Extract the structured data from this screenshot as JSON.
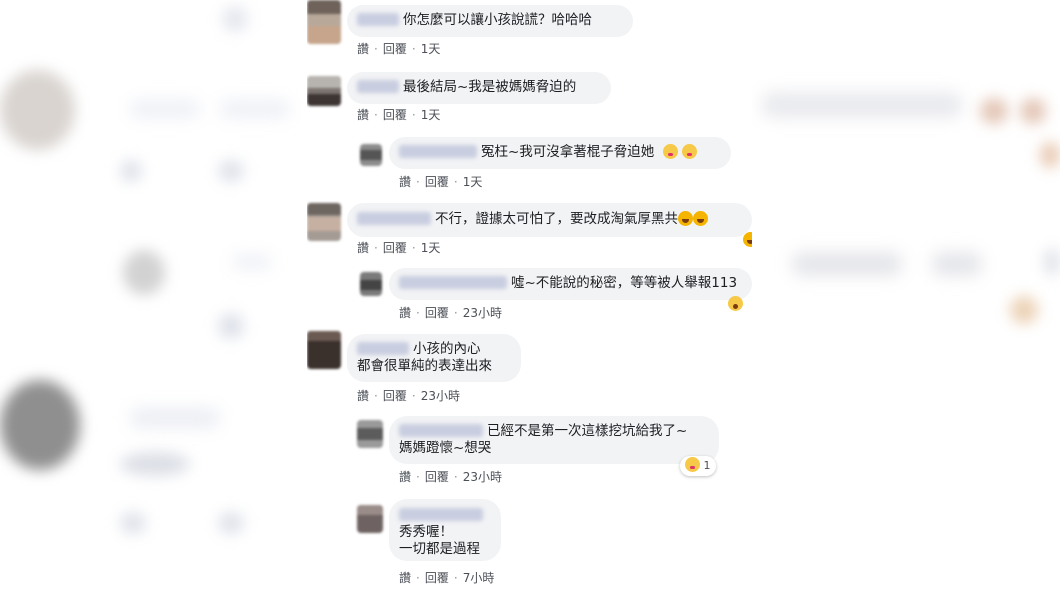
{
  "comments": [
    {
      "text": "你怎麼可以讓小孩說謊？哈哈哈",
      "like": "讚",
      "reply": "回覆",
      "time": "1天"
    },
    {
      "text": "最後結局~我是被媽媽脅迫的",
      "like": "讚",
      "reply": "回覆",
      "time": "1天"
    },
    {
      "text": "冤枉~我可沒拿著棍子脅迫她",
      "like": "讚",
      "reply": "回覆",
      "time": "1天",
      "emojis": [
        "kiss-emoji",
        "kiss-emoji"
      ]
    },
    {
      "text": "不行，證據太可怕了，要改成淘氣厚黑共",
      "like": "讚",
      "reply": "回覆",
      "time": "1天",
      "emojis": [
        "laugh-emoji",
        "laugh-emoji"
      ]
    },
    {
      "text": "噓~不能說的秘密，等等被人舉報113",
      "like": "讚",
      "reply": "回覆",
      "time": "23小時"
    },
    {
      "line1": "小孩的內心",
      "line2": "都會很單純的表達出來",
      "like": "讚",
      "reply": "回覆",
      "time": "23小時"
    },
    {
      "line1": "已經不是第一次這樣挖坑給我了~",
      "line2": "媽媽蹬懷~想哭",
      "like": "讚",
      "reply": "回覆",
      "time": "23小時",
      "reaction_count": "1"
    },
    {
      "line1": "秀秀喔！",
      "line2": "一切都是過程",
      "like": "讚",
      "reply": "回覆",
      "time": "7小時"
    }
  ],
  "colors": {
    "bubble": "#f2f3f5",
    "action_text": "#4b4f56",
    "text": "#1c1e21"
  }
}
